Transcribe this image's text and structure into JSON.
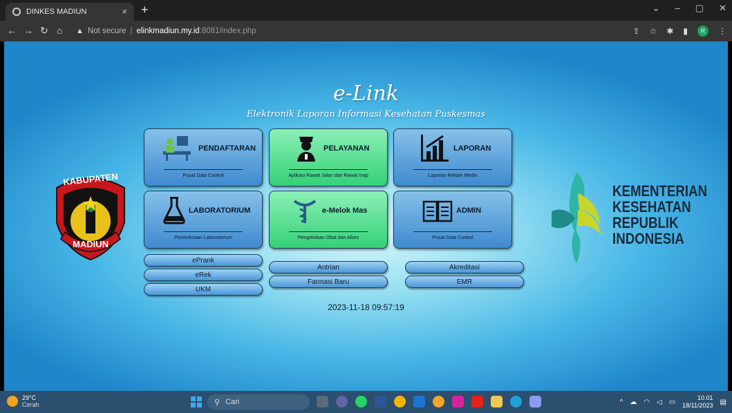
{
  "browser": {
    "tab_title": "DINKES MADIUN",
    "tab_close": "×",
    "new_tab": "+",
    "not_secure": "Not secure",
    "url_host": "elinkmadiun.my.id",
    "url_rest": ":8081/index.php"
  },
  "page": {
    "title": "e-Link",
    "subtitle": "Elektronik Laporan Informasi Kesehatan Puskesmas",
    "clock": "2023-11-18 09:57:19"
  },
  "cards": [
    {
      "label": "PENDAFTARAN",
      "sub": "Pusat Data Control",
      "icon": "registration-desk-icon",
      "color": "blue"
    },
    {
      "label": "PELAYANAN",
      "sub": "Aplikasi Rawat Jalan dan Rawat Inap",
      "icon": "nurse-icon",
      "color": "green"
    },
    {
      "label": "LAPORAN",
      "sub": "Laporan Rekam Medis",
      "icon": "bar-chart-icon",
      "color": "blue"
    },
    {
      "label": "LABORATORIUM",
      "sub": "Pemeriksaan Laboratorium",
      "icon": "flask-icon",
      "color": "blue"
    },
    {
      "label": "e-Melok Mas",
      "sub": "Pengelolaan Obat dan Alkes",
      "icon": "pharmacy-icon",
      "color": "green"
    },
    {
      "label": "ADMIN",
      "sub": "Pusat Data Control",
      "icon": "book-icon",
      "color": "blue"
    }
  ],
  "links": {
    "eprank": "ePrank",
    "erek": "eRek",
    "ukm": "UKM",
    "antrian": "Antrian",
    "farmasi": "Farmasi Baru",
    "akreditasi": "Akreditasi",
    "emr": "EMR"
  },
  "logo_left": {
    "top": "KABUPATEN",
    "bottom": "MADIUN"
  },
  "logo_right": {
    "lines": [
      "KEMENTERIAN",
      "KESEHATAN",
      "REPUBLIK",
      "INDONESIA"
    ]
  },
  "taskbar": {
    "temp": "29°C",
    "weather": "Cerah",
    "search": "Cari",
    "time": "10.01",
    "date": "18/11/2023"
  }
}
